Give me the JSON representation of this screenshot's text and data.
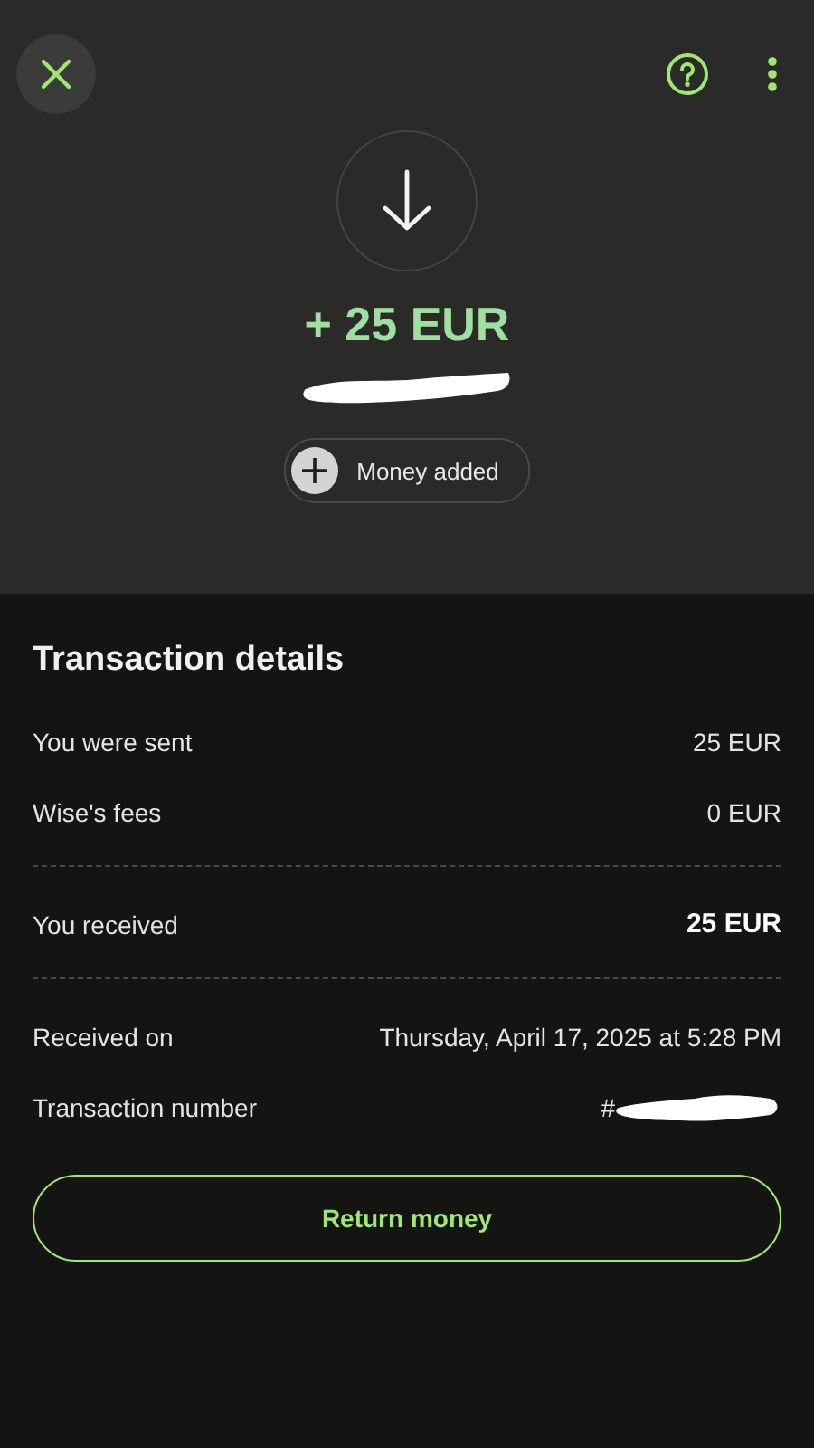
{
  "header": {
    "amount": "+ 25 EUR",
    "status": {
      "label": "Money added"
    }
  },
  "details": {
    "title": "Transaction details",
    "groups": [
      {
        "rows": [
          {
            "label": "You were sent",
            "value": "25 EUR",
            "emphasis": false
          },
          {
            "label": "Wise's fees",
            "value": "0 EUR",
            "emphasis": false
          }
        ]
      },
      {
        "rows": [
          {
            "label": "You received",
            "value": "25 EUR",
            "emphasis": true
          }
        ]
      },
      {
        "rows": [
          {
            "label": "Received on",
            "value": "Thursday, April 17, 2025 at 5:28 PM",
            "emphasis": false
          },
          {
            "label": "Transaction number",
            "value": "#",
            "emphasis": false,
            "redacted": true
          }
        ]
      }
    ]
  },
  "button": {
    "label": "Return money"
  }
}
